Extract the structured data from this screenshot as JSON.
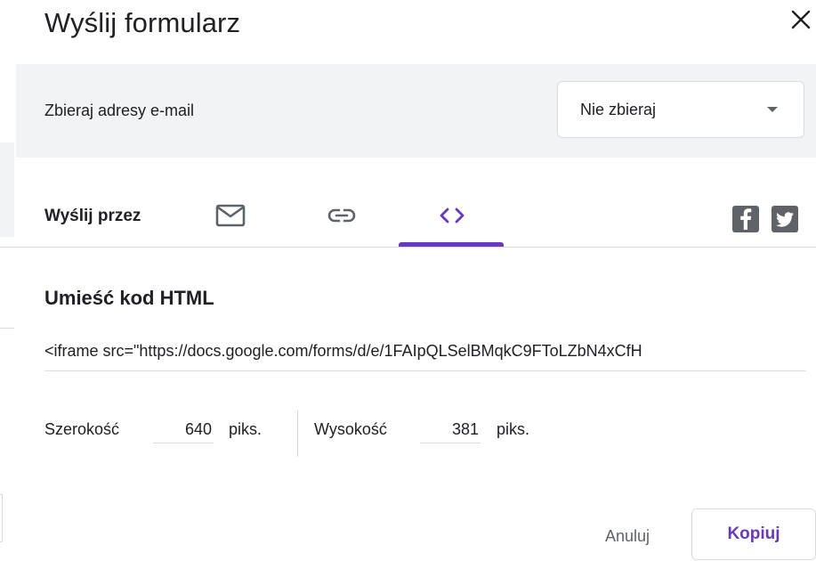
{
  "dialog": {
    "title": "Wyślij formularz",
    "close_icon": "close-icon"
  },
  "collect_emails": {
    "label": "Zbieraj adresy e-mail",
    "selected": "Nie zbieraj"
  },
  "send_via": {
    "label": "Wyślij przez",
    "tabs": [
      {
        "icon": "email-icon"
      },
      {
        "icon": "link-icon"
      },
      {
        "icon": "embed-code-icon",
        "active": true
      }
    ],
    "share": [
      "facebook-icon",
      "twitter-icon"
    ]
  },
  "embed": {
    "heading": "Umieść kod HTML",
    "code": "<iframe src=\"https://docs.google.com/forms/d/e/1FAIpQLSelBMqkC9FToLZbN4xCfH"
  },
  "dimensions": {
    "width_label": "Szerokość",
    "width_value": "640",
    "width_unit": "piks.",
    "height_label": "Wysokość",
    "height_value": "381",
    "height_unit": "piks."
  },
  "actions": {
    "cancel": "Anuluj",
    "copy": "Kopiuj"
  },
  "colors": {
    "accent": "#673ab7",
    "band": "#f1f3f4",
    "divider": "#dadce0"
  }
}
